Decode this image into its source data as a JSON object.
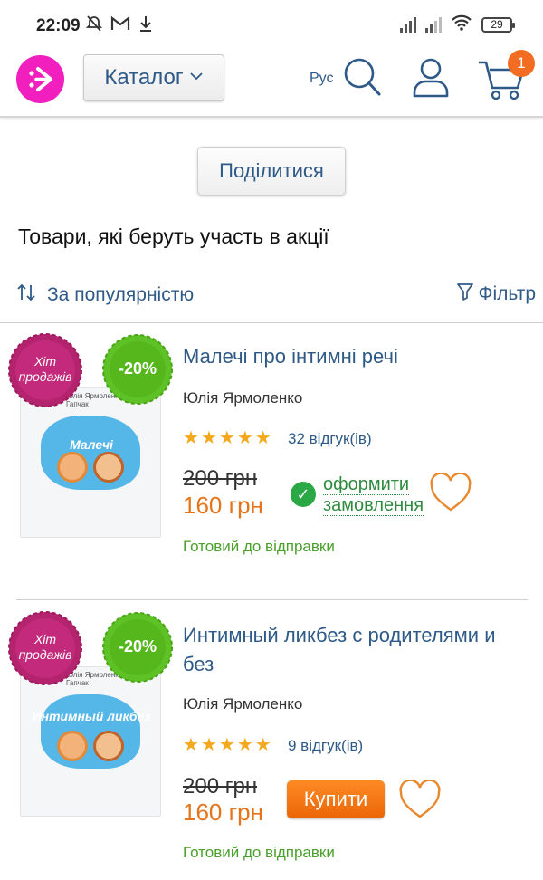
{
  "status_bar": {
    "time": "22:09",
    "battery": "29",
    "icons": [
      "alarm-off-icon",
      "gmail-icon",
      "download-icon",
      "signal-icon",
      "signal-icon",
      "wifi-icon",
      "battery-icon"
    ]
  },
  "header": {
    "logo_icon": "logo-icon",
    "catalog_label": "Каталог",
    "language": "Рус",
    "cart_count": "1",
    "colors": {
      "brand": "#f01fbd",
      "link": "#2f5a87",
      "accent": "#f26d22"
    }
  },
  "share_label": "Поділитися",
  "promo_title": "Товари, які беруть участь в акції",
  "toolbar": {
    "sort_label": "За популярністю",
    "filter_label": "Фільтр"
  },
  "products": [
    {
      "hit_badge": "Хіт продажів",
      "discount": "-20%",
      "cover_title": "Малечі",
      "cover_authors": "Юлія Ярмоленко Мар'яна Гапчак",
      "title": "Малечі про інтимні речі",
      "author": "Юлія Ярмоленко",
      "rating": 5,
      "reviews": "32 відгук(ів)",
      "old_price": "200 грн",
      "new_price": "160 грн",
      "action_line1": "оформити",
      "action_line2": "замовлення",
      "availability": "Готовий до відправки"
    },
    {
      "hit_badge": "Хіт продажів",
      "discount": "-20%",
      "cover_title": "Интимный ликбез",
      "cover_authors": "Юлія Ярмоленко Мар'яна Гапчак",
      "title": "Интимный ликбез с родителями и без",
      "author": "Юлія Ярмоленко",
      "rating": 5,
      "reviews": "9 відгук(ів)",
      "old_price": "200 грн",
      "new_price": "160 грн",
      "buy_label": "Купити",
      "availability": "Готовий до відправки"
    }
  ]
}
